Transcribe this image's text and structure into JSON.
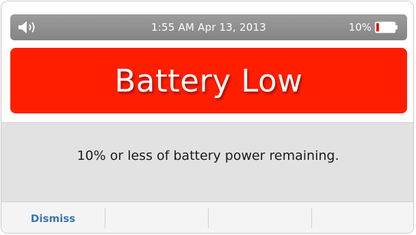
{
  "status_bar": {
    "volume_icon": "speaker-volume-icon",
    "datetime": "1:55 AM  Apr 13, 2013",
    "battery_percent": "10%",
    "battery_level": 0.1,
    "battery_icon": "battery-low-icon"
  },
  "alert": {
    "title": "Battery Low",
    "color": "#ff1e00"
  },
  "message": {
    "text": "10% or less of battery power remaining."
  },
  "actions": {
    "dismiss_label": "Dismiss",
    "accent": "#3a75b5"
  }
}
